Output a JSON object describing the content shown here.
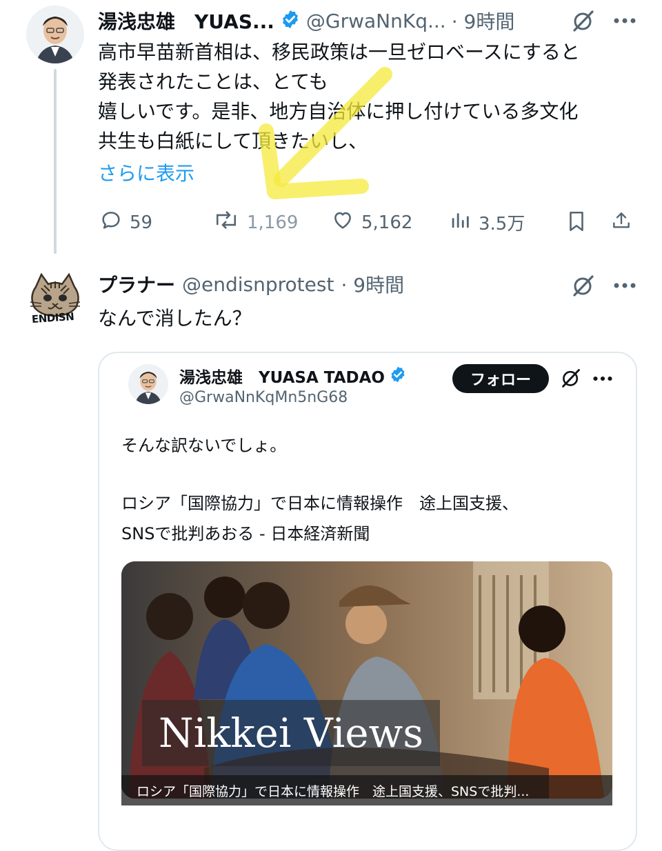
{
  "tweet": {
    "author_name": "湯浅忠雄　YUAS...",
    "handle": "@GrwaNnKq...",
    "time": "· 9時間",
    "lines": [
      "高市早苗新首相は、移民政策は一旦ゼロベースにすると",
      "発表されたことは、とても",
      "嬉しいです。是非、地方自治体に押し付けている多文化",
      "共生も白紙にして頂きたいし、"
    ],
    "show_more": "さらに表示",
    "replies": "59",
    "retweets": "1,169",
    "likes": "5,162",
    "views": "3.5万"
  },
  "reply": {
    "author_name": "プラナー",
    "handle": "@endisnprotest",
    "time": "· 9時間",
    "text": "なんで消したん？",
    "avatar_caption": "ENDISN"
  },
  "quoted": {
    "author_name": "湯浅忠雄　YUASA TADAO",
    "handle": "@GrwaNnKqMn5nG68",
    "follow_label": "フォロー",
    "text": "そんな訳ないでしょ。",
    "headline_lines": [
      "ロシア「国際協力」で日本に情報操作　途上国支援、",
      "SNSで批判あおる - 日本経済新聞"
    ],
    "image_title": "Nikkei Views",
    "image_caption": "ロシア「国際協力」で日本に情報操作　途上国支援、SNSで批判..."
  },
  "icons": {
    "verified": "verified-badge-icon",
    "grok": "grok-icon",
    "more": "more-icon",
    "reply": "reply-icon",
    "retweet": "retweet-icon",
    "like": "like-icon",
    "views": "views-icon",
    "bookmark": "bookmark-icon",
    "share": "share-icon"
  },
  "colors": {
    "accent": "#1d9bf0",
    "muted": "#536471",
    "highlight_arrow": "#f5ea3c"
  }
}
